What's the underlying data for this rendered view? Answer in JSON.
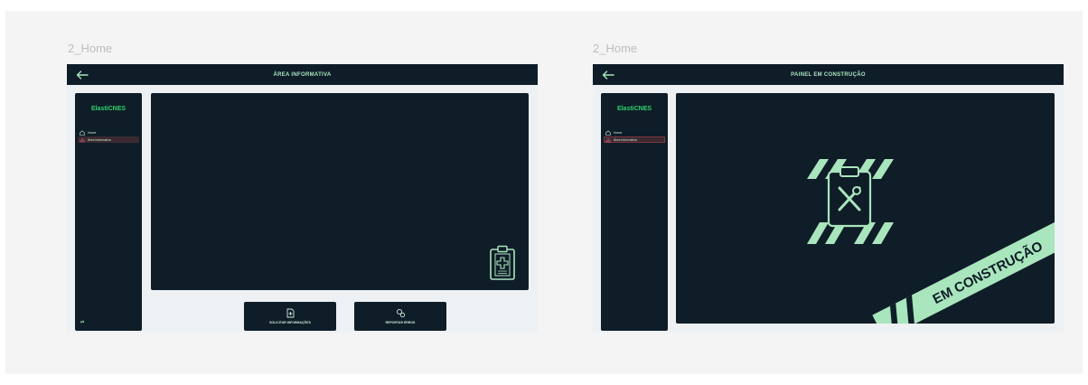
{
  "colors": {
    "dark": "#0f1d28",
    "accent": "#a9e5bd",
    "brand": "#2ed16b",
    "active_bg": "#3a2a30"
  },
  "frame_left": {
    "label": "2_Home",
    "header_title": "ÁREA INFORMATIVA",
    "sidebar": {
      "brand": "ElastiCNES",
      "items": [
        {
          "label": "Home",
          "icon": "home-icon",
          "active": false
        },
        {
          "label": "Área Informativa",
          "icon": "chart-icon",
          "active": true
        }
      ],
      "footer_icon": "logout-icon"
    },
    "main_icon": "clipboard-medical-icon",
    "buttons": [
      {
        "label": "SOLICITAR INFORMAÇÕES",
        "icon": "document-plus-icon"
      },
      {
        "label": "REPORTAR ERROS",
        "icon": "bug-icon"
      }
    ]
  },
  "frame_right": {
    "label": "2_Home",
    "header_title": "PAINEL EM CONSTRUÇÃO",
    "sidebar": {
      "brand": "ElastiCNES",
      "items": [
        {
          "label": "Home",
          "icon": "home-icon",
          "active": false
        },
        {
          "label": "Área Informativa",
          "icon": "chart-icon",
          "active": true
        }
      ]
    },
    "construction_icon": "clipboard-tools-icon",
    "tape_text": "EM CONSTRUÇÃO"
  }
}
